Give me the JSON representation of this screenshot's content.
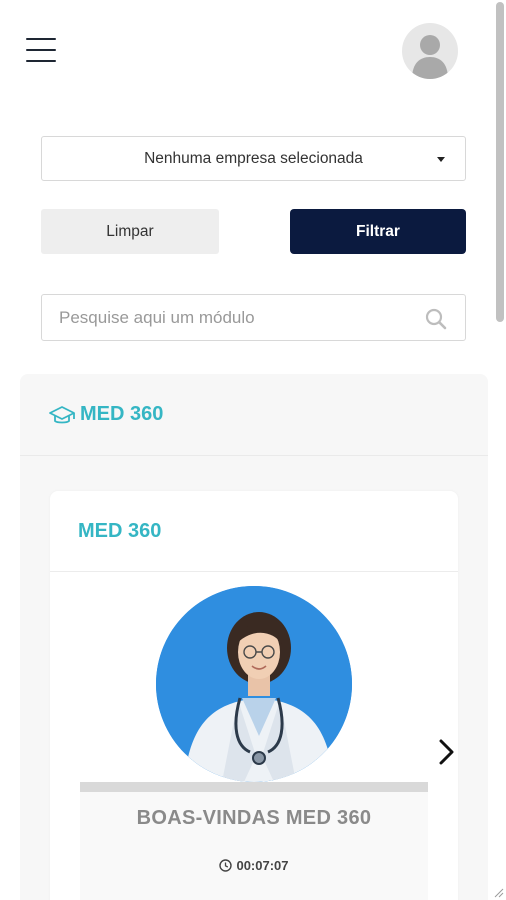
{
  "header": {
    "menu_icon": "hamburger-menu-icon",
    "avatar_icon": "user-avatar-icon"
  },
  "filters": {
    "company_select_value": "Nenhuma empresa selecionada",
    "clear_label": "Limpar",
    "filter_label": "Filtrar"
  },
  "search": {
    "placeholder": "Pesquise aqui um módulo",
    "icon": "search-icon"
  },
  "module": {
    "icon": "graduation-cap-icon",
    "title": "MED 360",
    "course": {
      "title": "MED 360",
      "video": {
        "title": "BOAS-VINDAS MED 360",
        "duration": "00:07:07"
      }
    }
  },
  "colors": {
    "accent": "#35b6c4",
    "primary_button": "#0b1a3f",
    "thumbnail_bg": "#2f8ee0"
  }
}
